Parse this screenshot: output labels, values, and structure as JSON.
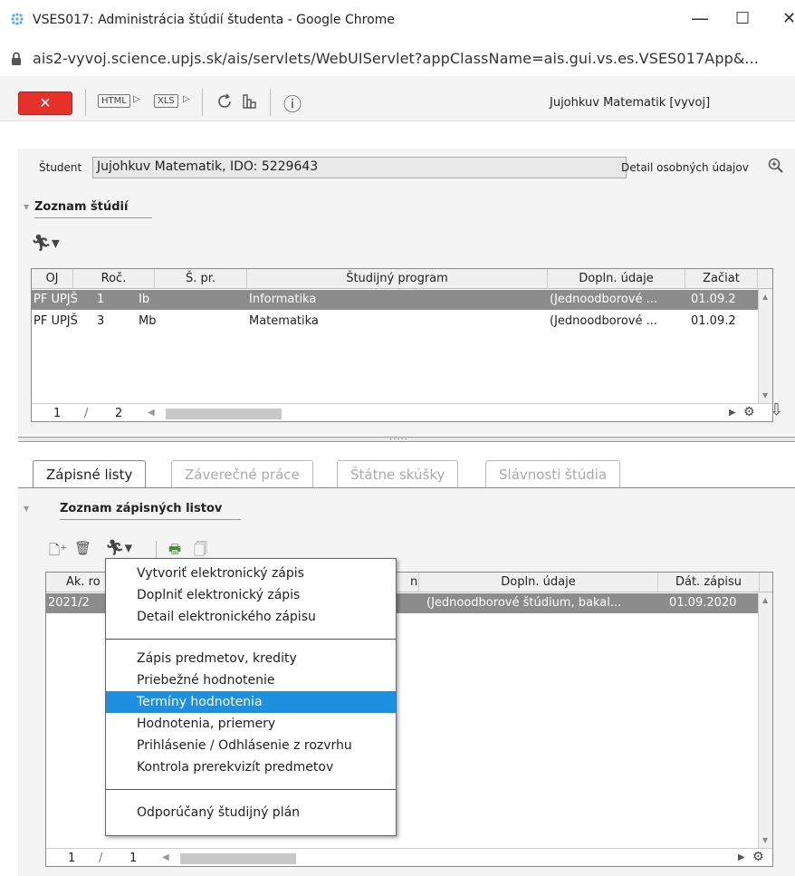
{
  "window": {
    "title": "VSES017: Administrácia štúdií študenta - Google Chrome",
    "url": "ais2-vyvoj.science.upjs.sk/ais/servlets/WebUIServlet?appClassName=ais.gui.vs.es.VSES017App&...",
    "minimize": "—",
    "maximize": "☐",
    "close": "✕"
  },
  "toolbar": {
    "close_label": "✕",
    "html_label": "HTML",
    "xls_label": "XLS",
    "info_label": "ⓘ",
    "user": "Jujohkuv Matematik [vyvoj]"
  },
  "student": {
    "label": "Študent",
    "value": "Jujohkuv Matematik, IDO: 5229643",
    "detail_link": "Detail osobných údajov"
  },
  "studies": {
    "header": "Zoznam štúdií",
    "columns": [
      "OJ",
      "Roč.",
      "Š. pr.",
      "Študijný program",
      "Dopln. údaje",
      "Začiat"
    ],
    "rows": [
      {
        "oj": "PF UPJŠ",
        "roc": "1",
        "spr": "Ib",
        "program": "Informatika",
        "dopln": "(Jednoodborové ...",
        "zac": "01.09.2"
      },
      {
        "oj": "PF UPJŠ",
        "roc": "3",
        "spr": "Mb",
        "program": "Matematika",
        "dopln": "(Jednoodborové ...",
        "zac": "01.09.2"
      }
    ],
    "page": "1",
    "slash": "/",
    "total": "2"
  },
  "tabs": [
    "Zápisné listy",
    "Záverečné práce",
    "Štátne skúšky",
    "Slávnosti štúdia"
  ],
  "enrolments": {
    "header": "Zoznam zápisných listov",
    "columns": [
      "Ak. ro",
      "n",
      "Dopln. údaje",
      "Dát. zápisu"
    ],
    "rows": [
      {
        "ak": "2021/2",
        "dopln": "(Jednoodborové štúdium, bakal...",
        "dat": "01.09.2020"
      }
    ],
    "page": "1",
    "slash": "/",
    "total": "1"
  },
  "menu": {
    "group1": [
      "Vytvoriť elektronický zápis",
      "Doplniť elektronický zápis",
      "Detail elektronického zápisu"
    ],
    "group2": [
      "Zápis predmetov, kredity",
      "Priebežné hodnotenie",
      "Termíny hodnotenia",
      "Hodnotenia, priemery",
      "Prihlásenie / Odhlásenie z rozvrhu",
      "Kontrola prerekvizít predmetov"
    ],
    "group3": [
      "Odporúčaný študijný plán"
    ],
    "highlighted": "Termíny hodnotenia"
  },
  "colors": {
    "close_red": "#e5312a",
    "selection_gray": "#8c8c8c",
    "menu_highlight": "#1f8fe0"
  }
}
